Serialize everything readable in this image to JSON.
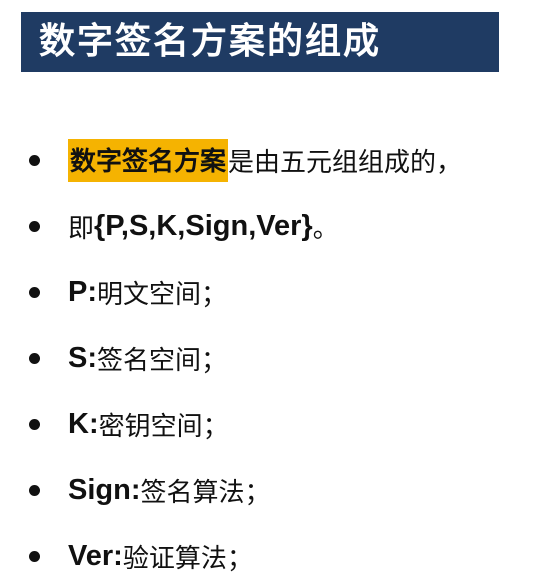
{
  "slide": {
    "title": "数字签名方案的组成"
  },
  "bullets": {
    "line1": {
      "highlight": "数字签名方案",
      "rest": "是由五元组组成的，"
    },
    "line2": {
      "prefix": "即",
      "formula": "{P,S,K,Sign,Ver}",
      "suffix": "。"
    },
    "line3": {
      "term": "P:",
      "desc": "明文空间；"
    },
    "line4": {
      "term": "S:",
      "desc": "签名空间；"
    },
    "line5": {
      "term": "K:",
      "desc": "密钥空间；"
    },
    "line6": {
      "term": "Sign:",
      "desc": "签名算法；"
    },
    "line7": {
      "term": "Ver:",
      "desc": "验证算法；"
    }
  },
  "colors": {
    "title_bar": "#1f3b63",
    "highlight": "#f5b301",
    "text": "#111111"
  }
}
